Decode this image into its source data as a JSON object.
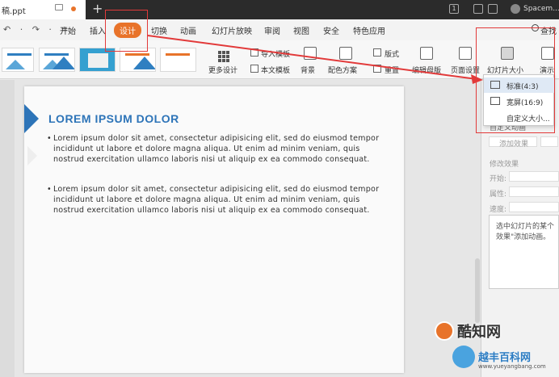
{
  "titlebar": {
    "doc_name": "稿.ppt",
    "new_tab": "+",
    "username": "Spacem..."
  },
  "menubar": {
    "undo_redo": "↶ · ↷ · ≐",
    "tabs": [
      "开始",
      "插入",
      "设计",
      "切换",
      "动画",
      "幻灯片放映",
      "审阅",
      "视图",
      "安全",
      "特色应用"
    ],
    "active_tab": "设计",
    "search_label": "查找"
  },
  "ribbon": {
    "more_designs": "更多设计",
    "import_template": "导入模板",
    "text_template": "本文模板",
    "background": "背景",
    "color_scheme": "配色方案",
    "layout": "版式",
    "reset": "重置",
    "edit_master": "编辑母版",
    "page_setup": "页面设置",
    "slide_size": "幻灯片大小",
    "presenter": "演示"
  },
  "slide_size_menu": {
    "items": [
      "标准(4:3)",
      "宽屏(16:9)",
      "自定义大小..."
    ]
  },
  "slide": {
    "title": "LOREM IPSUM DOLOR",
    "bullets": [
      "Lorem ipsum dolor sit amet, consectetur adipisicing elit, sed do eiusmod tempor incididunt ut labore et dolore magna aliqua. Ut enim ad minim veniam, quis nostrud exercitation ullamco laboris nisi ut aliquip ex ea commodo consequat.",
      "Lorem ipsum dolor sit amet, consectetur adipisicing elit, sed do eiusmod tempor incididunt ut labore et dolore magna aliqua. Ut enim ad minim veniam, quis nostrud exercitation ullamco laboris nisi ut aliquip ex ea commodo consequat."
    ]
  },
  "right_panel": {
    "custom_animation": "自定义动画",
    "add_effect": "添加效果",
    "modify_effect": "修改效果",
    "start": "开始:",
    "property": "属性:",
    "speed": "速度:",
    "hint_line1": "选中幻灯片的某个",
    "hint_line2": "效果\"添加动画。"
  },
  "watermarks": {
    "brand1": "酷知网",
    "brand2": "越丰百科网",
    "url": "www.yueyangbang.com"
  },
  "colors": {
    "accent": "#e8732a",
    "slide_blue": "#2d74b8",
    "annotation_red": "#e23a3a"
  }
}
